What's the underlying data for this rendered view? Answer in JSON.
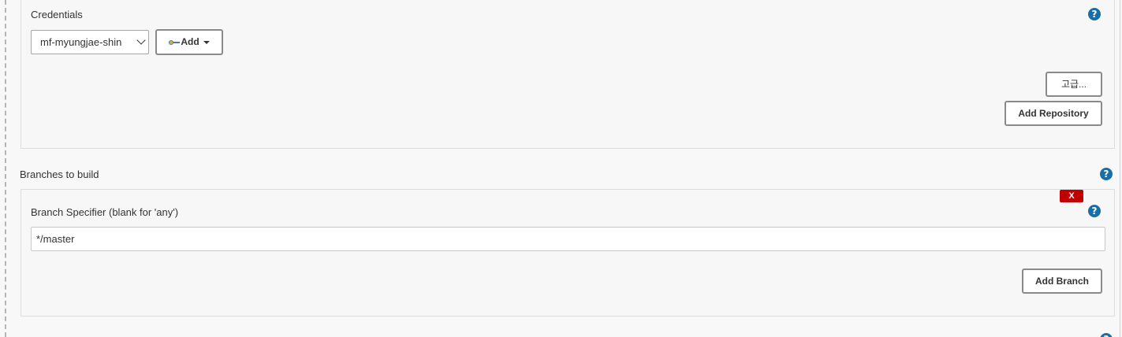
{
  "credentials": {
    "label": "Credentials",
    "help_icon": "?",
    "selected_value": "mf-myungjae-shin",
    "add_button_label": "Add",
    "advanced_button_label": "고급...",
    "add_repository_label": "Add Repository"
  },
  "branches": {
    "section_label": "Branches to build",
    "help_icon": "?",
    "delete_label": "X",
    "branch_specifier_label": "Branch Specifier (blank for 'any')",
    "branch_specifier_value": "*/master",
    "add_branch_label": "Add Branch"
  },
  "colors": {
    "help_icon": "#1a6ea6",
    "delete_button": "#c00000",
    "panel_background": "#f7f7f7"
  }
}
